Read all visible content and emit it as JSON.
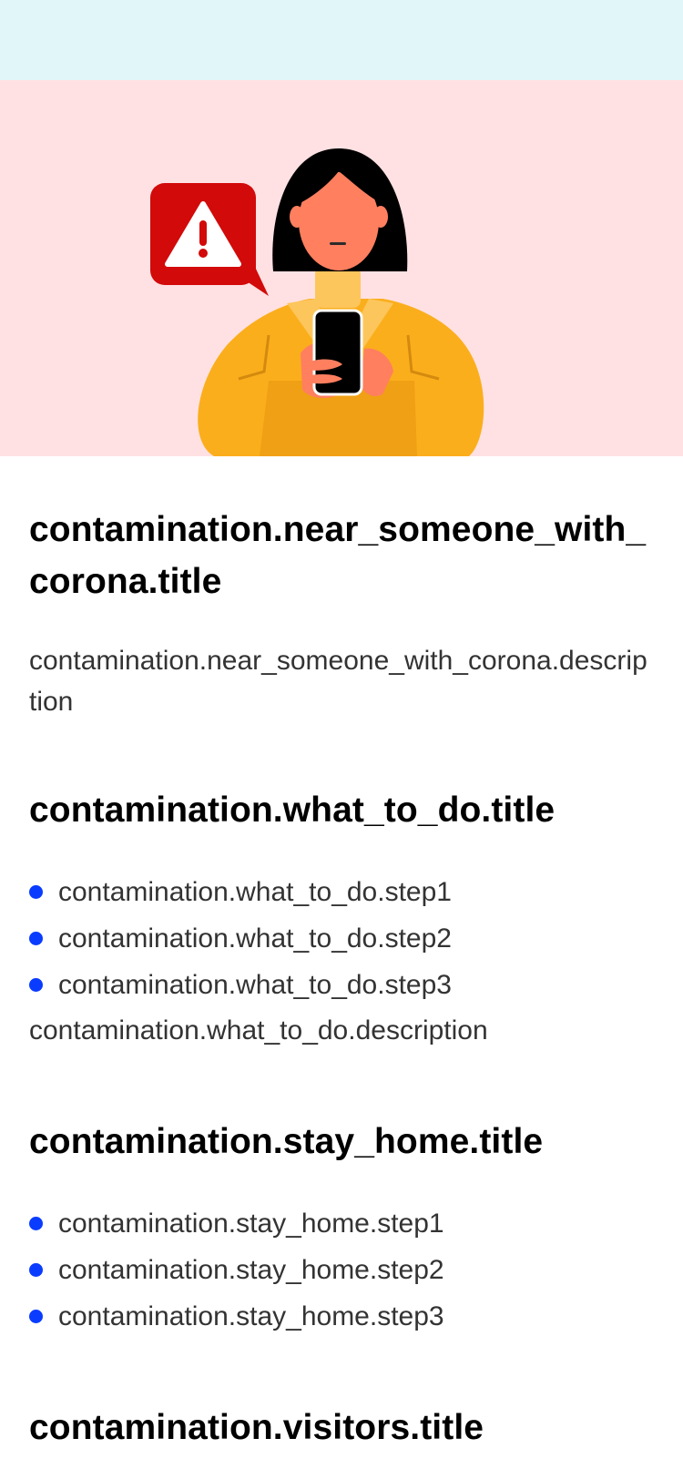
{
  "colors": {
    "status_bar_bg": "#e0f6f9",
    "hero_bg": "#ffe1e3",
    "bullet": "#0a3cff",
    "alert_red": "#d20a0a"
  },
  "hero": {
    "illustration": "woman-with-phone-alert-illustration",
    "alert_icon": "warning-triangle-icon"
  },
  "sections": {
    "near_someone": {
      "title": "contamination.near_someone_with_corona.title",
      "description": "contamination.near_someone_with_corona.description"
    },
    "what_to_do": {
      "title": "contamination.what_to_do.title",
      "steps": [
        "contamination.what_to_do.step1",
        "contamination.what_to_do.step2",
        "contamination.what_to_do.step3"
      ],
      "description": "contamination.what_to_do.description"
    },
    "stay_home": {
      "title": "contamination.stay_home.title",
      "steps": [
        "contamination.stay_home.step1",
        "contamination.stay_home.step2",
        "contamination.stay_home.step3"
      ]
    },
    "visitors": {
      "title": "contamination.visitors.title"
    }
  }
}
